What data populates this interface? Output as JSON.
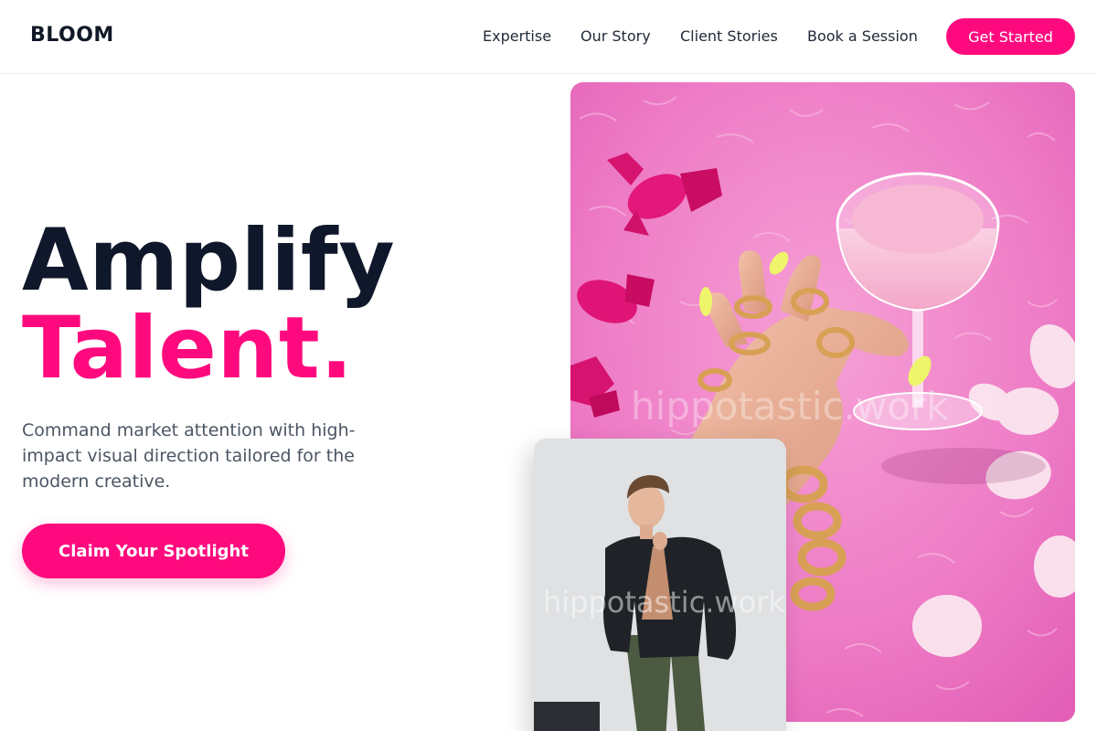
{
  "brand": {
    "logo": "BLOOM",
    "accent": "#ff0a7e",
    "dark": "#0f172a"
  },
  "nav": {
    "items": [
      {
        "label": "Expertise"
      },
      {
        "label": "Our Story"
      },
      {
        "label": "Client Stories"
      },
      {
        "label": "Book a Session"
      }
    ],
    "cta_label": "Get Started"
  },
  "hero": {
    "title_line1": "Amplify",
    "title_line2": "Talent.",
    "subtitle": "Command market attention with high-impact visual direction tailored for the modern creative.",
    "button_label": "Claim Your Spotlight"
  },
  "images": {
    "main": {
      "description_icon": "photo-hand-cocktail",
      "watermark": "hippotastic.work"
    },
    "secondary": {
      "description_icon": "photo-man-blazer",
      "watermark": "hippotastic.work"
    }
  }
}
